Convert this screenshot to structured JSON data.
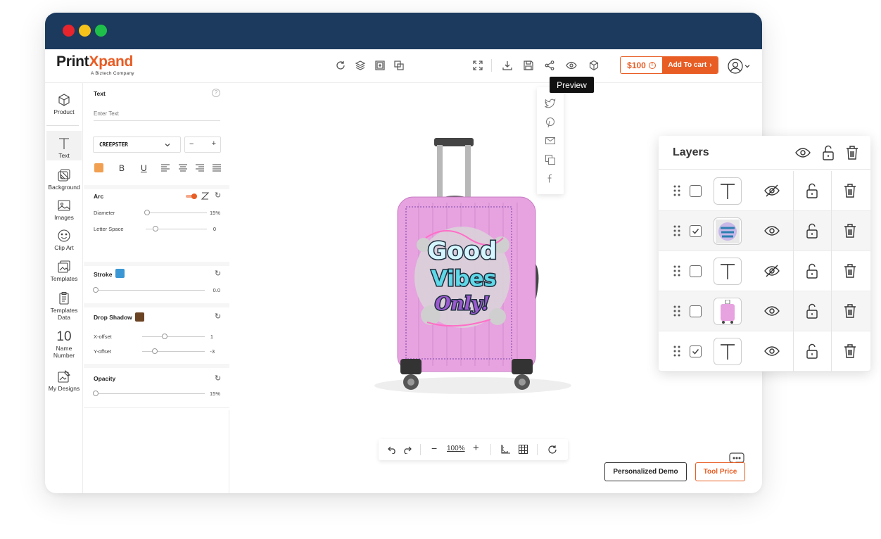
{
  "app": {
    "logo_main_a": "Print",
    "logo_main_x": "X",
    "logo_main_b": "pand",
    "logo_sub": "A Biztech Company"
  },
  "toolbar": {
    "price": "$100",
    "price_info": "!",
    "add_to_cart": "Add To cart",
    "preview_tooltip": "Preview"
  },
  "sidebar": {
    "items": [
      {
        "label": "Product",
        "icon": "cube-icon"
      },
      {
        "label": "Text",
        "icon": "text-t-icon"
      },
      {
        "label": "Background",
        "icon": "background-icon"
      },
      {
        "label": "Images",
        "icon": "image-icon"
      },
      {
        "label": "Clip Art",
        "icon": "smiley-icon"
      },
      {
        "label": "Templates",
        "icon": "templates-icon"
      },
      {
        "label": "Templates Data",
        "icon": "clipboard-icon"
      },
      {
        "label": "Name Number",
        "icon": "number-10-icon",
        "glyph": "10"
      },
      {
        "label": "My Designs",
        "icon": "designs-icon"
      }
    ]
  },
  "panel": {
    "text_title": "Text",
    "text_placeholder": "Enter Text",
    "font_name": "CREEPSTER",
    "font_size_minus": "−",
    "font_size_plus": "+",
    "bold": "B",
    "underline": "U",
    "arc_title": "Arc",
    "diameter_label": "Diameter",
    "diameter_value": "15%",
    "letter_space_label": "Letter Space",
    "letter_space_value": "0",
    "stroke_title": "Stroke",
    "stroke_value": "0.0",
    "drop_shadow_title": "Drop Shadow",
    "x_offset_label": "X-offset",
    "x_offset_value": "1",
    "y_offset_label": "Y-offset",
    "y_offset_value": "-3",
    "opacity_title": "Opacity",
    "opacity_value": "15%",
    "colors": {
      "text_color": "#f0a050",
      "stroke_color": "#3a97d4",
      "shadow_color": "#6b4423"
    }
  },
  "canvas": {
    "zoom": "100%",
    "artwork_line1": "Good",
    "artwork_line2": "Vibes",
    "artwork_line3": "Only!"
  },
  "buttons": {
    "personalized_demo": "Personalized Demo",
    "tool_price": "Tool Price"
  },
  "layers": {
    "title": "Layers",
    "rows": [
      {
        "type": "text",
        "checked": false,
        "visible": false
      },
      {
        "type": "artwork",
        "checked": true,
        "visible": true
      },
      {
        "type": "text",
        "checked": false,
        "visible": false
      },
      {
        "type": "suitcase",
        "checked": false,
        "visible": true
      },
      {
        "type": "text",
        "checked": true,
        "visible": true
      }
    ]
  },
  "theme": {
    "accent": "#e85d24",
    "titlebar": "#1c3a5e",
    "suitcase": "#e7a2e0"
  }
}
